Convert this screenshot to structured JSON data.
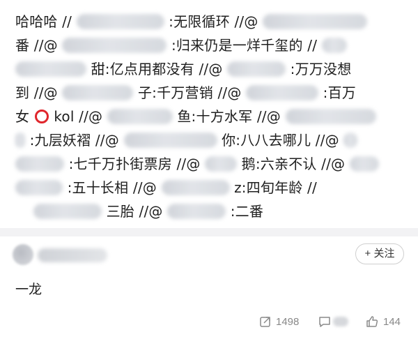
{
  "post": {
    "lines": [
      [
        "哈哈哈 //",
        ":无限循环 //@",
        ""
      ],
      [
        "番 //@",
        ":归来仍是一烊千玺的 //"
      ],
      [
        "",
        "甜:亿点用都没有 //@",
        ":万万没想"
      ],
      [
        "到 //@",
        "子:千万营销 //@",
        ":百万"
      ],
      [
        "女",
        "kol //@",
        "鱼:十方水军 //@"
      ],
      [
        ":九层妖褶 //@",
        "你:八八去哪儿 //@"
      ],
      [
        ":七千万扑街票房 //@",
        "鹅:六亲不认 //@"
      ],
      [
        ":五十长相 //@",
        "z:四旬年龄 //"
      ],
      [
        "三胎 //@",
        ":二番"
      ]
    ]
  },
  "comment": {
    "follow_label": "+ 关注",
    "text": "一龙"
  },
  "actions": {
    "share_count": "1498",
    "like_count": "144"
  },
  "colors": {
    "ring": "#e0262c",
    "divider": "#f2f2f4",
    "muted": "#888888"
  },
  "icons": [
    "ring-emoji-icon",
    "share-icon",
    "comment-icon",
    "like-icon"
  ]
}
